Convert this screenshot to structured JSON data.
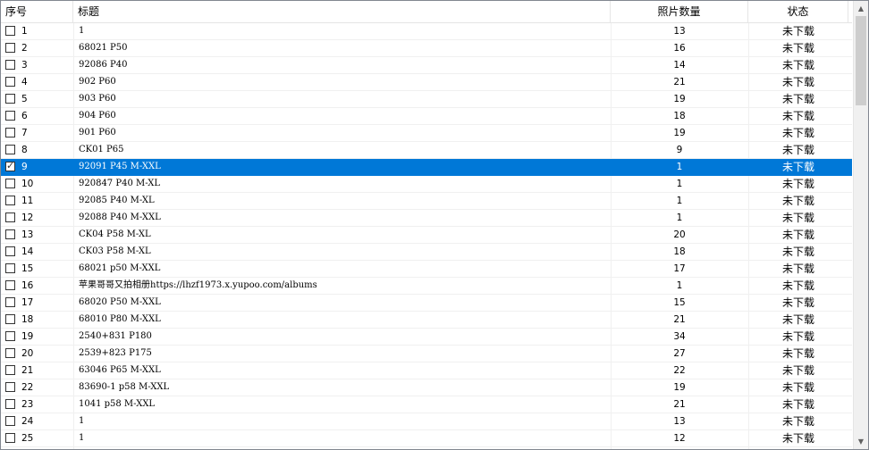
{
  "columns": {
    "index": "序号",
    "title": "标题",
    "photo_count": "照片数量",
    "status": "状态"
  },
  "rows": [
    {
      "index": "1",
      "title": "1",
      "count": "13",
      "status": "未下载",
      "checked": false,
      "selected": false
    },
    {
      "index": "2",
      "title": "68021  P50",
      "count": "16",
      "status": "未下载",
      "checked": false,
      "selected": false
    },
    {
      "index": "3",
      "title": "92086  P40",
      "count": "14",
      "status": "未下载",
      "checked": false,
      "selected": false
    },
    {
      "index": "4",
      "title": "902 P60",
      "count": "21",
      "status": "未下载",
      "checked": false,
      "selected": false
    },
    {
      "index": "5",
      "title": "903 P60",
      "count": "19",
      "status": "未下载",
      "checked": false,
      "selected": false
    },
    {
      "index": "6",
      "title": "904 P60",
      "count": "18",
      "status": "未下载",
      "checked": false,
      "selected": false
    },
    {
      "index": "7",
      "title": "901 P60",
      "count": "19",
      "status": "未下载",
      "checked": false,
      "selected": false
    },
    {
      "index": "8",
      "title": "CK01  P65",
      "count": "9",
      "status": "未下载",
      "checked": false,
      "selected": false
    },
    {
      "index": "9",
      "title": "92091 P45 M-XXL",
      "count": "1",
      "status": "未下载",
      "checked": true,
      "selected": true
    },
    {
      "index": "10",
      "title": "920847 P40 M-XL",
      "count": "1",
      "status": "未下载",
      "checked": false,
      "selected": false
    },
    {
      "index": "11",
      "title": "92085 P40 M-XL",
      "count": "1",
      "status": "未下载",
      "checked": false,
      "selected": false
    },
    {
      "index": "12",
      "title": "92088 P40 M-XXL",
      "count": "1",
      "status": "未下载",
      "checked": false,
      "selected": false
    },
    {
      "index": "13",
      "title": "CK04 P58 M-XL",
      "count": "20",
      "status": "未下载",
      "checked": false,
      "selected": false
    },
    {
      "index": "14",
      "title": "CK03 P58 M-XL",
      "count": "18",
      "status": "未下载",
      "checked": false,
      "selected": false
    },
    {
      "index": "15",
      "title": "68021 p50 M-XXL",
      "count": "17",
      "status": "未下载",
      "checked": false,
      "selected": false
    },
    {
      "index": "16",
      "title": "苹果哥哥又拍相册https://lhzf1973.x.yupoo.com/albums",
      "count": "1",
      "status": "未下载",
      "checked": false,
      "selected": false
    },
    {
      "index": "17",
      "title": "68020 P50 M-XXL",
      "count": "15",
      "status": "未下载",
      "checked": false,
      "selected": false
    },
    {
      "index": "18",
      "title": "68010 P80 M-XXL",
      "count": "21",
      "status": "未下载",
      "checked": false,
      "selected": false
    },
    {
      "index": "19",
      "title": "2540+831 P180",
      "count": "34",
      "status": "未下载",
      "checked": false,
      "selected": false
    },
    {
      "index": "20",
      "title": "2539+823   P175",
      "count": "27",
      "status": "未下载",
      "checked": false,
      "selected": false
    },
    {
      "index": "21",
      "title": "63046 P65 M-XXL",
      "count": "22",
      "status": "未下载",
      "checked": false,
      "selected": false
    },
    {
      "index": "22",
      "title": "83690-1 p58 M-XXL",
      "count": "19",
      "status": "未下载",
      "checked": false,
      "selected": false
    },
    {
      "index": "23",
      "title": "1041 p58 M-XXL",
      "count": "21",
      "status": "未下载",
      "checked": false,
      "selected": false
    },
    {
      "index": "24",
      "title": "1",
      "count": "13",
      "status": "未下载",
      "checked": false,
      "selected": false
    },
    {
      "index": "25",
      "title": "1",
      "count": "12",
      "status": "未下载",
      "checked": false,
      "selected": false
    }
  ],
  "scrollbar": {
    "up_icon": "scroll-up-arrow-icon",
    "down_icon": "scroll-down-arrow-icon"
  },
  "colors": {
    "selection": "#0078d7",
    "grid": "#f0f0f0",
    "border": "#828790"
  }
}
